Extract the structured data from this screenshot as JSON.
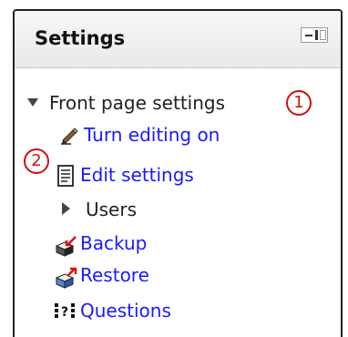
{
  "block": {
    "title": "Settings"
  },
  "tree": {
    "front_page": "Front page settings",
    "turn_editing": "Turn editing on",
    "edit_settings": "Edit settings",
    "users": "Users",
    "backup": "Backup",
    "restore": "Restore",
    "questions": "Questions"
  },
  "callouts": {
    "one": "1",
    "two": "2"
  },
  "icons": {
    "dock": "dock-block-icon",
    "collapse": "triangle-down-icon",
    "expand": "triangle-right-icon",
    "edit": "pencil-edit-icon",
    "settings": "document-settings-icon",
    "backup": "backup-box-icon",
    "restore": "restore-box-icon",
    "questions": "questions-icon"
  },
  "colors": {
    "link": "#1a1aff",
    "callout": "#cc1111"
  }
}
